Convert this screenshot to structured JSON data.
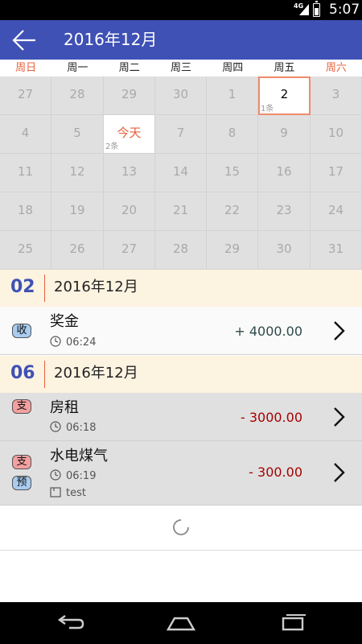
{
  "status_bar": {
    "network": "4G",
    "time": "5:07"
  },
  "app_bar": {
    "title": "2016年12月",
    "back_icon": "arrow-left-icon"
  },
  "weekdays": [
    "周日",
    "周一",
    "周二",
    "周三",
    "周四",
    "周五",
    "周六"
  ],
  "calendar": {
    "rows": [
      [
        "27",
        "28",
        "29",
        "30",
        "1",
        "2",
        "3"
      ],
      [
        "4",
        "5",
        "今天",
        "7",
        "8",
        "9",
        "10"
      ],
      [
        "11",
        "12",
        "13",
        "14",
        "15",
        "16",
        "17"
      ],
      [
        "18",
        "19",
        "20",
        "21",
        "22",
        "23",
        "24"
      ],
      [
        "25",
        "26",
        "27",
        "28",
        "29",
        "30",
        "31"
      ]
    ],
    "today_label": "今天",
    "today_count": "2条",
    "selected_day": "2",
    "selected_count": "1条"
  },
  "sections": [
    {
      "day": "02",
      "month": "2016年12月",
      "records": [
        {
          "badges": [
            "收"
          ],
          "name": "奖金",
          "time": "06:24",
          "note": "",
          "amount": "+ 4000.00"
        }
      ]
    },
    {
      "day": "06",
      "month": "2016年12月",
      "records": [
        {
          "badges": [
            "支"
          ],
          "name": "房租",
          "time": "06:18",
          "note": "",
          "amount": "- 3000.00"
        },
        {
          "badges": [
            "支",
            "预"
          ],
          "name": "水电煤气",
          "time": "06:19",
          "note": "test",
          "amount": "- 300.00"
        }
      ]
    }
  ],
  "colors": {
    "primary": "#3f51b5",
    "accent": "#e8603c",
    "income_badge": "#a9ccf0",
    "expense_badge": "#f3a0a0",
    "section_bg": "#fdf3e1",
    "negative_amount": "#a60000",
    "positive_amount": "#2e4a4a"
  },
  "nav_bar": {
    "icons": [
      "back-icon",
      "home-icon",
      "recents-icon"
    ]
  }
}
